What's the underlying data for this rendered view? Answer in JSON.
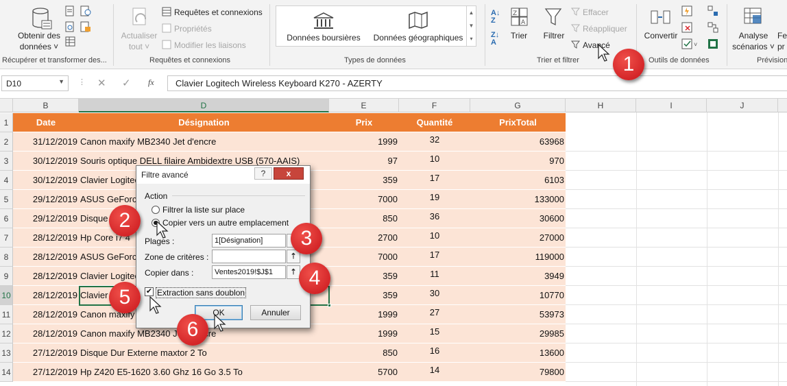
{
  "ribbon": {
    "groups": {
      "get_transform": "Récupérer et transformer des...",
      "queries": "Requêtes et connexions",
      "datatypes": "Types de données",
      "sort_filter": "Trier et filtrer",
      "datatools": "Outils de données",
      "forecast": "Prévision"
    },
    "get_data": [
      "Obtenir des",
      "données ˅"
    ],
    "refresh": [
      "Actualiser",
      "tout ˅"
    ],
    "queries_items": [
      "Requêtes et connexions",
      "Propriétés",
      "Modifier les liaisons"
    ],
    "stocks": "Données boursières",
    "geo": "Données géographiques",
    "sort": "Trier",
    "filter": "Filtrer",
    "clear": "Effacer",
    "reapply": "Réappliquer",
    "advanced": "Avancé",
    "convert": "Convertir",
    "whatif": [
      "Analyse",
      "scénarios ˅"
    ],
    "forecast_cut": [
      "Fe",
      "pr"
    ]
  },
  "formula_bar": {
    "name_box": "D10",
    "fx": "fx",
    "value": "Clavier Logitech Wireless Keyboard K270 - AZERTY"
  },
  "columns": [
    "B",
    "D",
    "E",
    "F",
    "G",
    "H",
    "I",
    "J"
  ],
  "header_row": {
    "num": "1",
    "date": "Date",
    "designation": "Désignation",
    "prix": "Prix",
    "quantite": "Quantité",
    "total": "PrixTotal"
  },
  "rows": [
    {
      "num": "2",
      "date": "31/12/2019",
      "designation": "Canon maxify MB2340 Jet d'encre",
      "prix": "1999",
      "quantite": "32",
      "total": "63968"
    },
    {
      "num": "3",
      "date": "30/12/2019",
      "designation": "Souris optique DELL filaire Ambidextre USB (570-AAIS)",
      "prix": "97",
      "quantite": "10",
      "total": "970"
    },
    {
      "num": "4",
      "date": "30/12/2019",
      "designation": "Clavier Logitech",
      "prix": "359",
      "quantite": "17",
      "total": "6103"
    },
    {
      "num": "5",
      "date": "29/12/2019",
      "designation": "ASUS GeForce",
      "prix": "7000",
      "quantite": "19",
      "total": "133000"
    },
    {
      "num": "6",
      "date": "29/12/2019",
      "designation": "Disque Dur",
      "prix": "850",
      "quantite": "36",
      "total": "30600"
    },
    {
      "num": "7",
      "date": "28/12/2019",
      "designation": "Hp Core i7 4",
      "prix": "2700",
      "quantite": "10",
      "total": "27000"
    },
    {
      "num": "8",
      "date": "28/12/2019",
      "designation": "ASUS GeForce",
      "prix": "7000",
      "quantite": "17",
      "total": "119000"
    },
    {
      "num": "9",
      "date": "28/12/2019",
      "designation": "Clavier Logitech",
      "prix": "359",
      "quantite": "11",
      "total": "3949"
    },
    {
      "num": "10",
      "date": "28/12/2019",
      "designation": "Clavier Le",
      "prix": "359",
      "quantite": "30",
      "total": "10770"
    },
    {
      "num": "11",
      "date": "28/12/2019",
      "designation": "Canon maxify",
      "prix": "1999",
      "quantite": "27",
      "total": "53973"
    },
    {
      "num": "12",
      "date": "28/12/2019",
      "designation": "Canon maxify MB2340 Jet d'encre",
      "prix": "1999",
      "quantite": "15",
      "total": "29985"
    },
    {
      "num": "13",
      "date": "27/12/2019",
      "designation": "Disque Dur Externe maxtor 2 To",
      "prix": "850",
      "quantite": "16",
      "total": "13600"
    },
    {
      "num": "14",
      "date": "27/12/2019",
      "designation": "Hp Z420 E5-1620 3.60 Ghz 16 Go 3.5 To",
      "prix": "5700",
      "quantite": "14",
      "total": "79800"
    }
  ],
  "dialog": {
    "title": "Filtre avancé",
    "help": "?",
    "close": "x",
    "action_label": "Action",
    "radio_filter": "Filtrer la liste sur place",
    "radio_copy": "Copier vers un autre emplacement",
    "plages_label": "Plages :",
    "plages_value": "1[Désignation]",
    "criteres_label": "Zone de critères :",
    "criteres_value": "",
    "copier_label": "Copier dans :",
    "copier_value": "Ventes2019!$J$1",
    "unique_label": "Extraction sans doublon",
    "unique_checked": true,
    "ok": "OK",
    "cancel": "Annuler"
  },
  "badges": [
    "1",
    "2",
    "3",
    "4",
    "5",
    "6"
  ],
  "colors": {
    "header": "#ed7d31",
    "row": "#fce4d6",
    "badge": "#d9262b",
    "accent": "#217346"
  }
}
